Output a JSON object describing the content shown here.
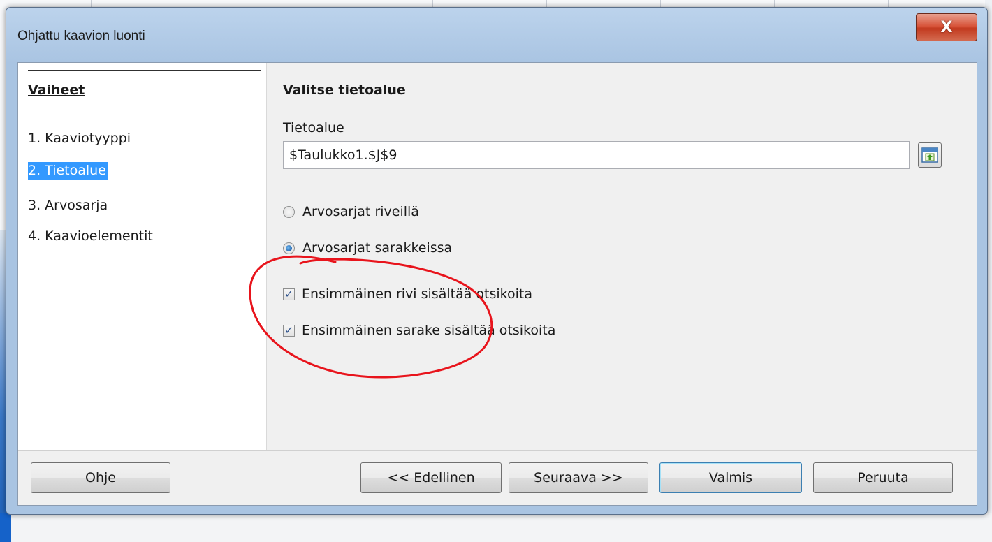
{
  "window": {
    "title": "Ohjattu kaavion luonti",
    "close_glyph": "X"
  },
  "steps": {
    "heading": "Vaiheet",
    "items": [
      {
        "label": "1. Kaaviotyyppi",
        "active": false
      },
      {
        "label": "2. Tietoalue",
        "active": true
      },
      {
        "label": "3. Arvosarja",
        "active": false
      },
      {
        "label": "4. Kaavioelementit",
        "active": false
      }
    ]
  },
  "page": {
    "heading": "Valitse tietoalue",
    "range_label": "Tietoalue",
    "range_value": "$Taulukko1.$J$9",
    "options": {
      "rows_label": "Arvosarjat riveillä",
      "rows_checked": false,
      "columns_label": "Arvosarjat sarakkeissa",
      "columns_checked": true
    },
    "checkboxes": {
      "first_row_label": "Ensimmäinen rivi sisältää otsikoita",
      "first_row_checked": true,
      "first_column_label": "Ensimmäinen sarake sisältää otsikoita",
      "first_column_checked": true
    }
  },
  "buttons": {
    "help": "Ohje",
    "back": "<< Edellinen",
    "next": "Seuraava >>",
    "finish": "Valmis",
    "cancel": "Peruuta"
  },
  "colors": {
    "selection": "#3399ff",
    "annotation": "#e8141c",
    "title_bar": "#a9c4e2",
    "close_button": "#c9452b"
  },
  "icons": {
    "shrink_button": "shrink-range-icon",
    "close": "close-icon"
  }
}
